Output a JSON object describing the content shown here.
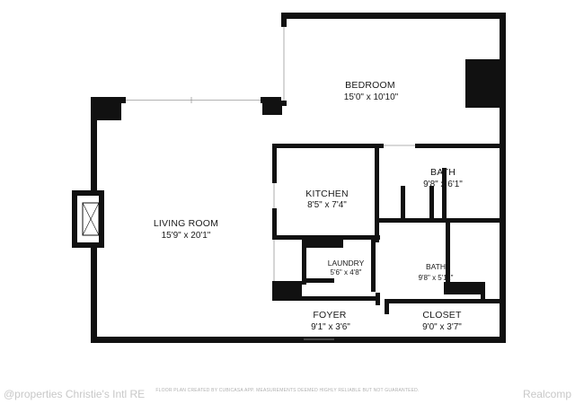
{
  "rooms": {
    "bedroom": {
      "name": "BEDROOM",
      "dims": "15'0\" x 10'10\""
    },
    "living_room": {
      "name": "LIVING ROOM",
      "dims": "15'9\" x 20'1\""
    },
    "kitchen": {
      "name": "KITCHEN",
      "dims": "8'5\" x 7'4\""
    },
    "bath_upper": {
      "name": "BATH",
      "dims": "9'8\" x 6'1\""
    },
    "laundry": {
      "name": "LAUNDRY",
      "dims": "5'6\" x 4'8\""
    },
    "bath_lower": {
      "name": "BATH",
      "dims": "9'8\" x 5'11\""
    },
    "foyer": {
      "name": "FOYER",
      "dims": "9'1\" x 3'6\""
    },
    "closet": {
      "name": "CLOSET",
      "dims": "9'0\" x 3'7\""
    }
  },
  "footer": {
    "left": "@properties Christie's Intl RE",
    "center": "FLOOR PLAN CREATED BY CUBICASA APP. MEASUREMENTS DEEMED HIGHLY RELIABLE BUT NOT GUARANTEED.",
    "right": "Realcomp"
  },
  "colors": {
    "wall": "#111111",
    "window": "#cccccc",
    "watermark": "#c8c8c8"
  }
}
